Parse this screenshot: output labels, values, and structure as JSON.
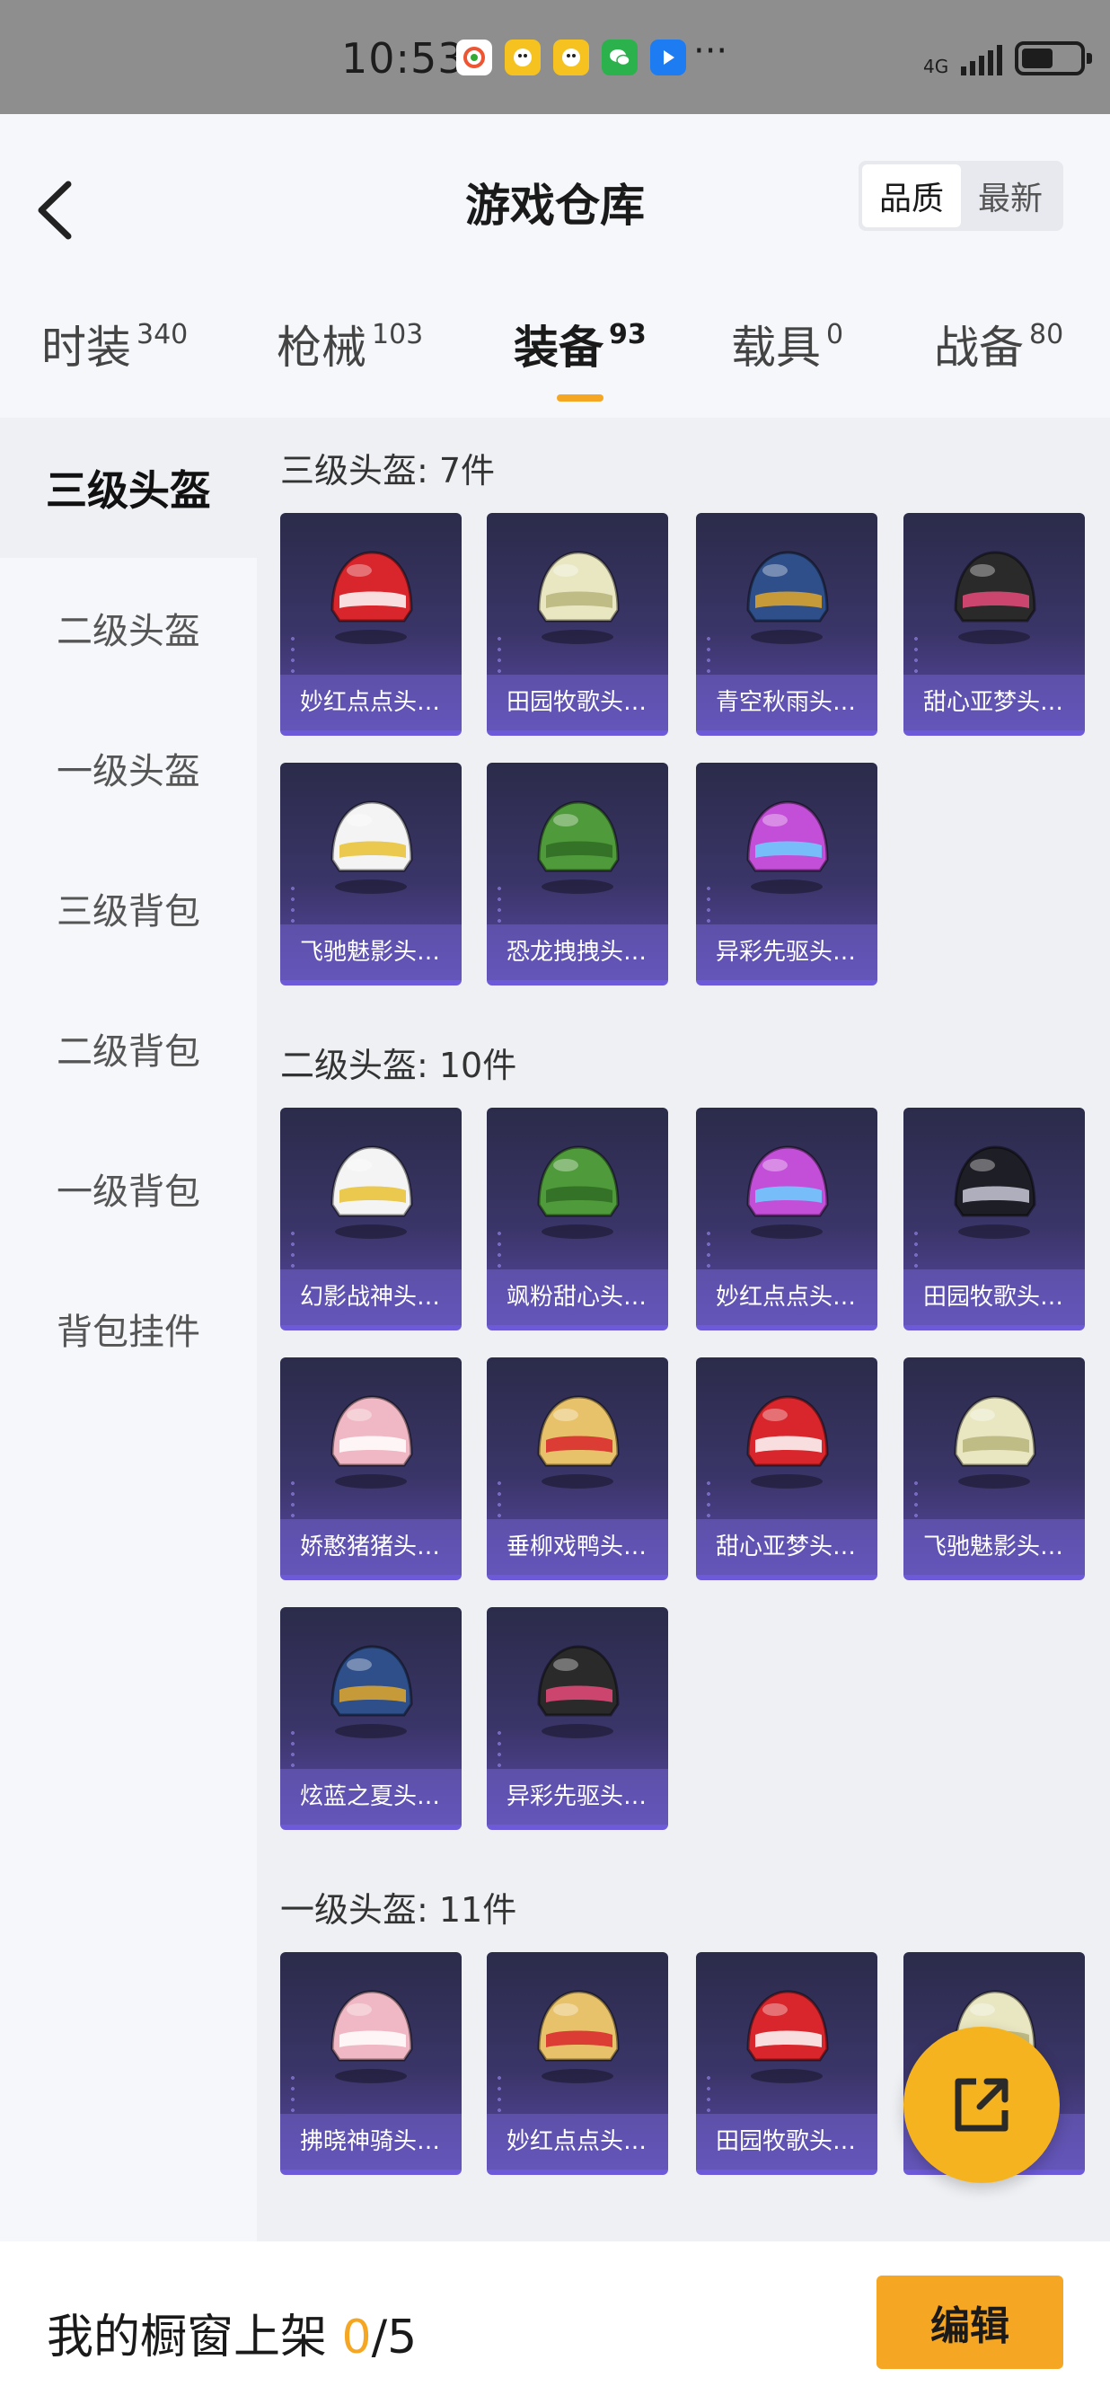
{
  "status_bar": {
    "time": "10:53",
    "network": "4G",
    "more": "···"
  },
  "header": {
    "title": "游戏仓库",
    "sort_options": [
      "品质",
      "最新"
    ]
  },
  "tabs": [
    {
      "label": "时装",
      "count": "340"
    },
    {
      "label": "枪械",
      "count": "103"
    },
    {
      "label": "装备",
      "count": "93"
    },
    {
      "label": "载具",
      "count": "0"
    },
    {
      "label": "战备",
      "count": "80"
    }
  ],
  "sidebar": [
    "三级头盔",
    "二级头盔",
    "一级头盔",
    "三级背包",
    "二级背包",
    "一级背包",
    "背包挂件"
  ],
  "sections": [
    {
      "title": "三级头盔: 7件",
      "items": [
        "妙红点点头…",
        "田园牧歌头…",
        "青空秋雨头…",
        "甜心亚梦头…",
        "飞驰魅影头…",
        "恐龙拽拽头…",
        "异彩先驱头…"
      ]
    },
    {
      "title": "二级头盔: 10件",
      "items": [
        "幻影战神头…",
        "飒粉甜心头…",
        "妙红点点头…",
        "田园牧歌头…",
        "娇憨猪猪头…",
        "垂柳戏鸭头…",
        "甜心亚梦头…",
        "飞驰魅影头…",
        "炫蓝之夏头…",
        "异彩先驱头…"
      ]
    },
    {
      "title": "一级头盔: 11件",
      "items": [
        "拂晓神骑头…",
        "妙红点点头…",
        "田园牧歌头…",
        ""
      ]
    }
  ],
  "bottom_bar": {
    "label": "我的橱窗上架 ",
    "current": "0",
    "total": "/5",
    "edit": "编辑"
  }
}
